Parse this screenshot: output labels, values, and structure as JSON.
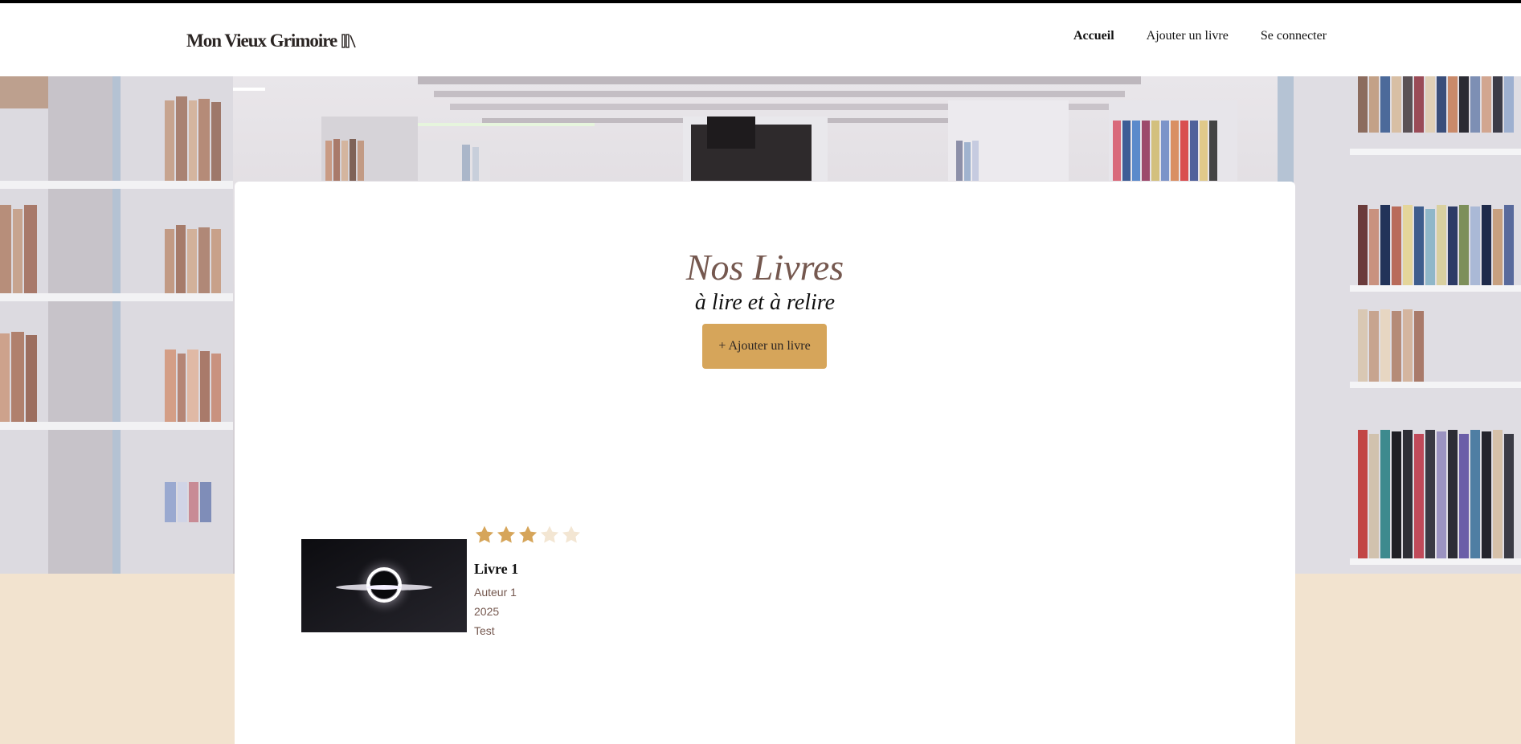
{
  "header": {
    "logo_text": "Mon Vieux Grimoire",
    "logo_icon": "books-icon",
    "nav": [
      {
        "label": "Accueil",
        "active": true
      },
      {
        "label": "Ajouter un livre",
        "active": false
      },
      {
        "label": "Se connecter",
        "active": false
      }
    ]
  },
  "main": {
    "title": "Nos Livres",
    "subtitle": "à lire et à relire",
    "add_button": "+ Ajouter un livre"
  },
  "books": [
    {
      "title": "Livre 1",
      "author": "Auteur 1",
      "year": "2025",
      "genre": "Test",
      "rating": 3,
      "max_rating": 5,
      "cover": "black-hole-image"
    }
  ],
  "colors": {
    "accent": "#d6a55a",
    "brown_text": "#75584f",
    "page_bg": "#f2e3cf",
    "star_empty": "#f3e6d3"
  }
}
